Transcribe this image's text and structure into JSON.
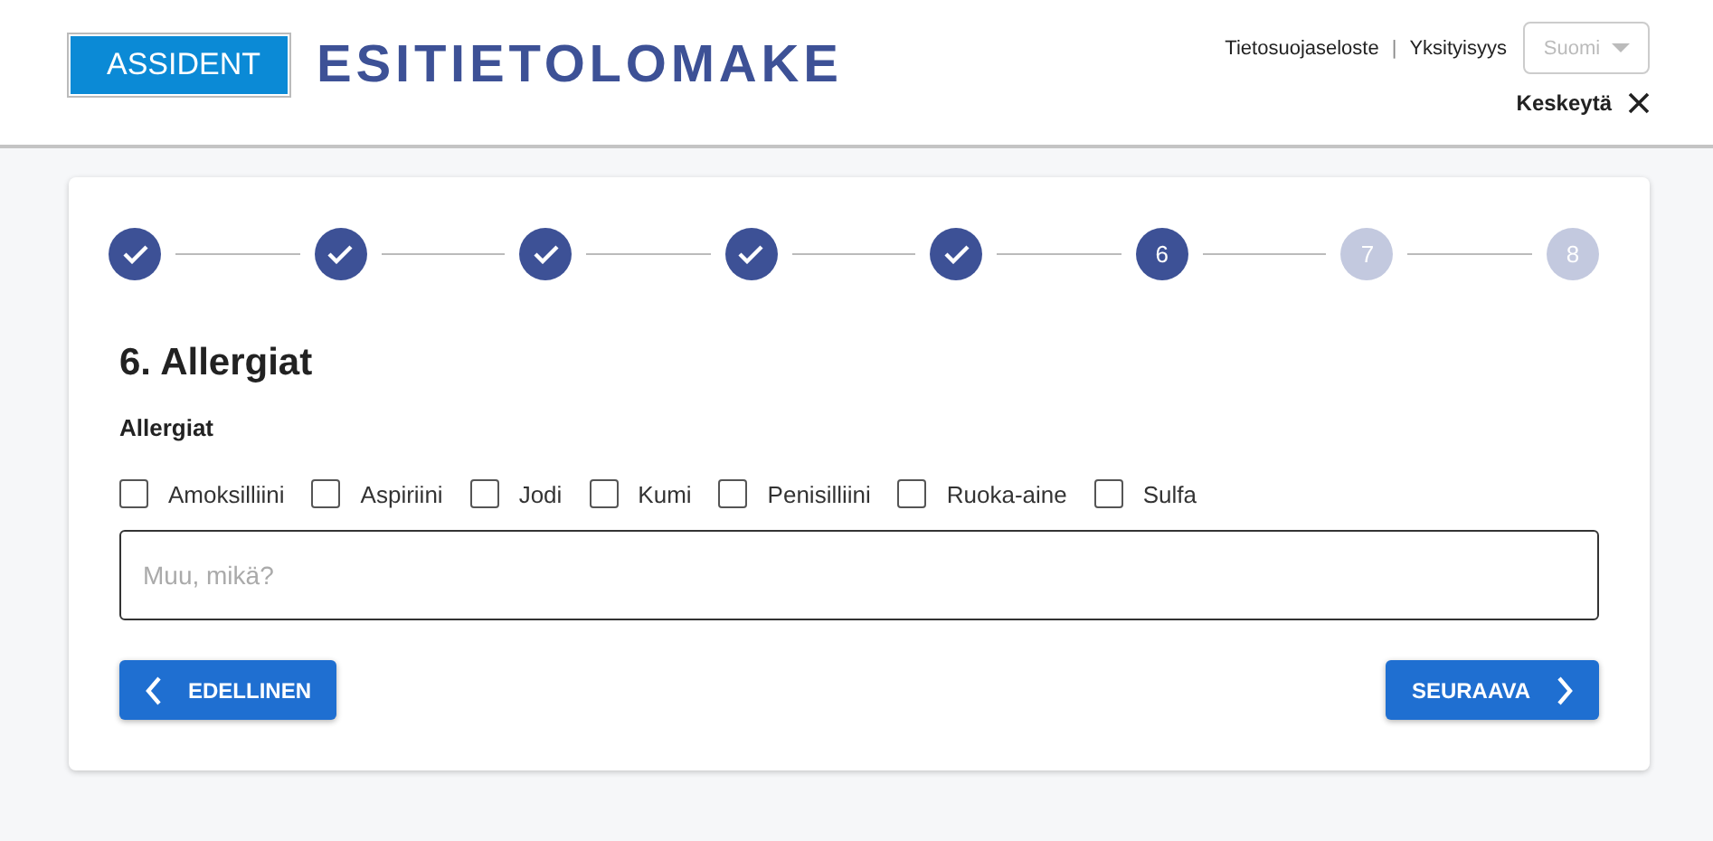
{
  "header": {
    "logo": "ASSIDENT",
    "title": "ESITIETOLOMAKE",
    "links": [
      {
        "label": "Tietosuojaseloste"
      },
      {
        "label": "Yksityisyys"
      }
    ],
    "separator": "|",
    "language": {
      "value": "Suomi",
      "disabled": true
    },
    "cancel": {
      "label": "Keskeytä"
    }
  },
  "stepper": [
    {
      "kind": "done"
    },
    {
      "kind": "done"
    },
    {
      "kind": "done"
    },
    {
      "kind": "done"
    },
    {
      "kind": "done"
    },
    {
      "kind": "current",
      "label": "6"
    },
    {
      "kind": "upcoming",
      "label": "7"
    },
    {
      "kind": "upcoming",
      "label": "8"
    }
  ],
  "section": {
    "title": "6. Allergiat",
    "group_label": "Allergiat",
    "options": [
      {
        "label": "Amoksilliini",
        "checked": false
      },
      {
        "label": "Aspiriini",
        "checked": false
      },
      {
        "label": "Jodi",
        "checked": false
      },
      {
        "label": "Kumi",
        "checked": false
      },
      {
        "label": "Penisilliini",
        "checked": false
      },
      {
        "label": "Ruoka-aine",
        "checked": false
      },
      {
        "label": "Sulfa",
        "checked": false
      }
    ],
    "other": {
      "placeholder": "Muu, mikä?"
    }
  },
  "buttons": {
    "previous": "EDELLINEN",
    "next": "SEURAAVA"
  }
}
